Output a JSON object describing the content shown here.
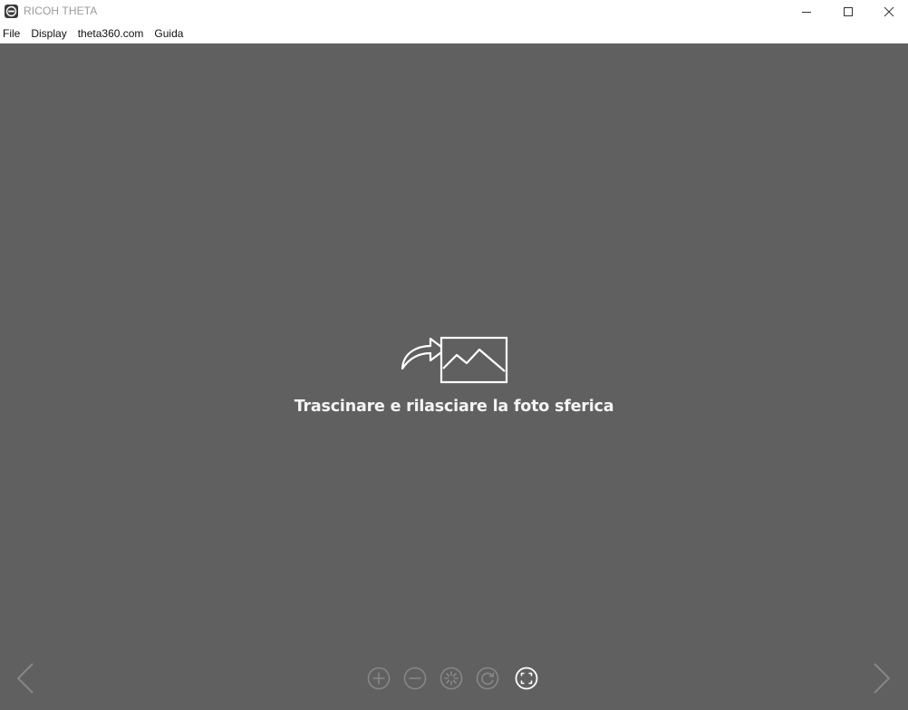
{
  "window": {
    "title": "RICOH THETA",
    "app_icon": "ricoh-theta-icon",
    "controls": {
      "minimize_icon": "minimize-icon",
      "maximize_icon": "maximize-icon",
      "close_icon": "close-icon"
    }
  },
  "menubar": {
    "items": [
      {
        "label": "File"
      },
      {
        "label": "Display"
      },
      {
        "label": "theta360.com"
      },
      {
        "label": "Guida"
      }
    ]
  },
  "viewer": {
    "drop_icon": "drag-drop-image-icon",
    "drop_message": "Trascinare e rilasciare la foto sferica",
    "nav": {
      "prev_icon": "chevron-left-icon",
      "next_icon": "chevron-right-icon"
    },
    "toolbar": [
      {
        "icon": "zoom-in-icon"
      },
      {
        "icon": "zoom-out-icon"
      },
      {
        "icon": "auto-play-icon"
      },
      {
        "icon": "rotate-icon"
      },
      {
        "icon": "fit-screen-icon"
      }
    ]
  },
  "colors": {
    "viewer_background": "#606060",
    "disabled_control": "#878787",
    "active_control": "#ffffff",
    "title_text": "#9a9a9a"
  }
}
